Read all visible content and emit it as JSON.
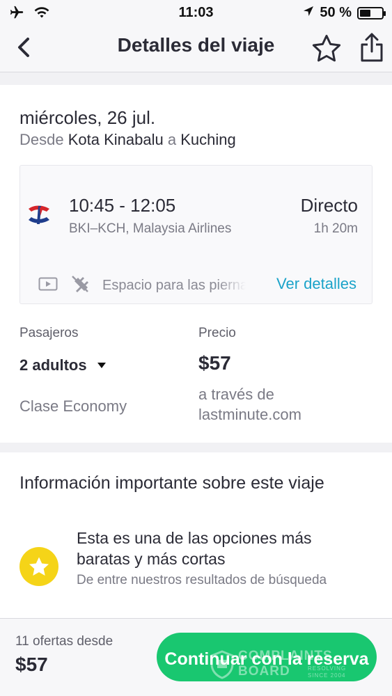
{
  "status_bar": {
    "time": "11:03",
    "battery_text": "50 %",
    "battery_level": 0.5,
    "icons": [
      "airplane-icon",
      "wifi-icon",
      "location-arrow-icon",
      "battery-icon"
    ]
  },
  "nav": {
    "title": "Detalles del viaje",
    "back_icon": "chevron-left-icon",
    "favorite_icon": "star-icon",
    "share_icon": "share-icon"
  },
  "trip": {
    "date": "miércoles, 26 jul.",
    "route_from_word": "Desde",
    "origin": "Kota Kinabalu",
    "route_to_word": "a",
    "destination": "Kuching",
    "flight": {
      "times": "10:45 - 12:05",
      "legs": "BKI–KCH, Malaysia Airlines",
      "type": "Directo",
      "duration": "1h 20m",
      "amenities_text": "Espacio para las piernas",
      "details_link": "Ver detalles",
      "amenity_icons": [
        "video-icon",
        "no-power-icon"
      ]
    },
    "passengers": {
      "label": "Pasajeros",
      "value": "2 adultos",
      "class": "Clase Economy"
    },
    "price": {
      "label": "Precio",
      "value": "$57",
      "via": "a través de lastminute.com"
    }
  },
  "info": {
    "title": "Información importante sobre este viaje",
    "heading": "Esta es una de las opciones más baratas y más cortas",
    "subtext": "De entre nuestros resultados de búsqueda",
    "icon": "star-badge-icon"
  },
  "bottom": {
    "offers_text": "11 ofertas desde",
    "offers_price": "$57",
    "continue_label": "Continuar con la reserva"
  },
  "watermark": {
    "line1": "COMPLAINTS",
    "line2": "BOARD",
    "small": "RESOLVING SINCE 2004"
  },
  "colors": {
    "accent_green": "#19c770",
    "link_blue": "#1ba3c9",
    "badge_yellow": "#f5d418",
    "text_dark": "#2b2b36",
    "text_muted": "#7a7a85"
  }
}
